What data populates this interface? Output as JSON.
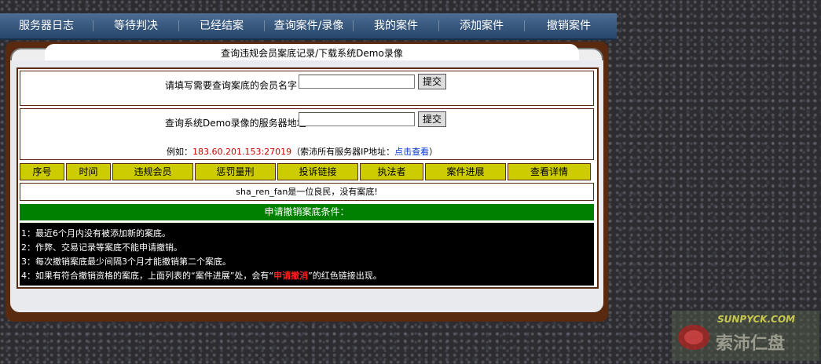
{
  "nav": {
    "items": [
      "服务器日志",
      "等待判决",
      "已经结案",
      "查询案件/录像",
      "我的案件",
      "添加案件",
      "撤销案件"
    ]
  },
  "panel": {
    "title": "查询违规会员案底记录/下载系统Demo录像"
  },
  "member_query": {
    "label": "请填写需要查询案底的会员名字",
    "value": "",
    "submit_label": "提交"
  },
  "server_query": {
    "label": "查询系统Demo录像的服务器地址",
    "value": "",
    "submit_label": "提交",
    "example_prefix": "例如：",
    "example_ip": "183.60.201.153:27019",
    "example_suffix": "（索沛所有服务器IP地址：",
    "example_link": "点击查看",
    "example_end": "）"
  },
  "table": {
    "headers": [
      "序号",
      "时间",
      "违规会员",
      "惩罚量刑",
      "投诉链接",
      "执法者",
      "案件进展",
      "查看详情"
    ],
    "empty_message": "sha_ren_fan是一位良民，没有案底!"
  },
  "conditions": {
    "title": "申请撤销案底条件：",
    "lines": [
      "1：最近6个月内没有被添加新的案底。",
      "2：作弊、交易记录等案底不能申请撤销。",
      "3：每次撤销案底最少间隔3个月才能撤销第二个案底。"
    ],
    "line4_prefix": "4：如果有符合撤销资格的案底，上面列表的“案件进展”处，会有“",
    "line4_highlight": "申请撤消",
    "line4_suffix": "”的红色链接出现。"
  },
  "logo": {
    "text_top": "SUNPYCK.COM",
    "text_bottom": "索沛仁盘"
  },
  "colors": {
    "nav_bg": "#3a5a80",
    "panel_brown": "#5a2a10",
    "header_yellow": "#cccc00",
    "green_bar": "#008000",
    "example_red": "#cc0000",
    "link_blue": "#0033cc",
    "highlight_red": "#ff2020"
  }
}
